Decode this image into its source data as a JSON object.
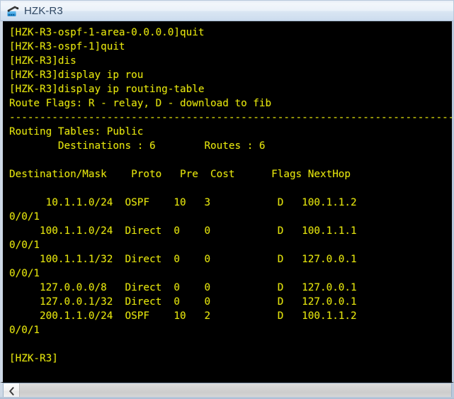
{
  "window": {
    "title": "HZK-R3",
    "icon": "router-terminal-icon"
  },
  "terminal": {
    "prompt_hostname": "HZK-R3",
    "text_color": "#e3e30d",
    "background_color": "#000000",
    "lines": [
      "[HZK-R3-ospf-1-area-0.0.0.0]quit",
      "[HZK-R3-ospf-1]quit",
      "[HZK-R3]dis",
      "[HZK-R3]display ip rou",
      "[HZK-R3]display ip routing-table",
      "Route Flags: R - relay, D - download to fib",
      "------------------------------------------------------------------------------",
      "Routing Tables: Public",
      "        Destinations : 6        Routes : 6",
      "",
      "Destination/Mask    Proto   Pre  Cost      Flags NextHop",
      "",
      "      10.1.1.0/24  OSPF    10   3           D   100.1.1.2",
      "0/0/1",
      "     100.1.1.0/24  Direct  0    0           D   100.1.1.1",
      "0/0/1",
      "     100.1.1.1/32  Direct  0    0           D   127.0.0.1",
      "0/0/1",
      "     127.0.0.0/8   Direct  0    0           D   127.0.0.1",
      "     127.0.0.1/32  Direct  0    0           D   127.0.0.1",
      "     200.1.1.0/24  OSPF    10   2           D   100.1.1.2",
      "0/0/1",
      "",
      "[HZK-R3]"
    ],
    "commands": [
      "quit",
      "quit",
      "dis",
      "display ip rou",
      "display ip routing-table"
    ],
    "route_flags_legend": "Route Flags: R - relay, D - download to fib",
    "routing_table_name": "Routing Tables: Public",
    "destinations_count": "6",
    "routes_count": "6",
    "columns": [
      "Destination/Mask",
      "Proto",
      "Pre",
      "Cost",
      "Flags",
      "NextHop"
    ],
    "routes": [
      {
        "destination_mask": "10.1.1.0/24",
        "proto": "OSPF",
        "pre": "10",
        "cost": "3",
        "flags": "D",
        "nexthop": "100.1.1.2",
        "interface": "0/0/1"
      },
      {
        "destination_mask": "100.1.1.0/24",
        "proto": "Direct",
        "pre": "0",
        "cost": "0",
        "flags": "D",
        "nexthop": "100.1.1.1",
        "interface": "0/0/1"
      },
      {
        "destination_mask": "100.1.1.1/32",
        "proto": "Direct",
        "pre": "0",
        "cost": "0",
        "flags": "D",
        "nexthop": "127.0.0.1",
        "interface": "0/0/1"
      },
      {
        "destination_mask": "127.0.0.0/8",
        "proto": "Direct",
        "pre": "0",
        "cost": "0",
        "flags": "D",
        "nexthop": "127.0.0.1",
        "interface": ""
      },
      {
        "destination_mask": "127.0.0.1/32",
        "proto": "Direct",
        "pre": "0",
        "cost": "0",
        "flags": "D",
        "nexthop": "127.0.0.1",
        "interface": ""
      },
      {
        "destination_mask": "200.1.1.0/24",
        "proto": "OSPF",
        "pre": "10",
        "cost": "2",
        "flags": "D",
        "nexthop": "100.1.1.2",
        "interface": "0/0/1"
      }
    ],
    "final_prompt": "[HZK-R3]"
  },
  "scrollbar": {
    "orientation": "horizontal",
    "left_arrow": "chevron-left-icon"
  }
}
